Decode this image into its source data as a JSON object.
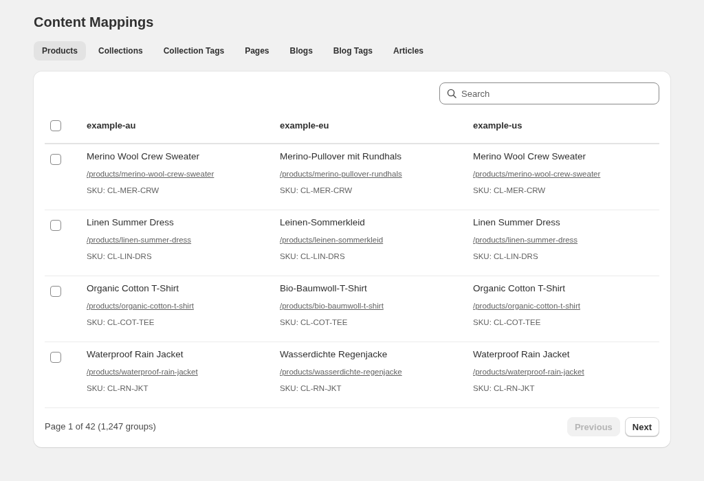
{
  "page": {
    "title": "Content Mappings"
  },
  "tabs": [
    {
      "label": "Products",
      "selected": true
    },
    {
      "label": "Collections",
      "selected": false
    },
    {
      "label": "Collection Tags",
      "selected": false
    },
    {
      "label": "Pages",
      "selected": false
    },
    {
      "label": "Blogs",
      "selected": false
    },
    {
      "label": "Blog Tags",
      "selected": false
    },
    {
      "label": "Articles",
      "selected": false
    }
  ],
  "search": {
    "placeholder": "Search"
  },
  "table": {
    "select_all": {
      "checked": false
    },
    "columns": [
      "example-au",
      "example-eu",
      "example-us"
    ],
    "rows": [
      {
        "checked": false,
        "cells": [
          {
            "name": "Merino Wool Crew Sweater",
            "url": "/products/merino-wool-crew-sweater",
            "sku": "SKU: CL-MER-CRW"
          },
          {
            "name": "Merino-Pullover mit Rundhals",
            "url": "/products/merino-pullover-rundhals",
            "sku": "SKU: CL-MER-CRW"
          },
          {
            "name": "Merino Wool Crew Sweater",
            "url": "/products/merino-wool-crew-sweater",
            "sku": "SKU: CL-MER-CRW"
          }
        ]
      },
      {
        "checked": false,
        "cells": [
          {
            "name": "Linen Summer Dress",
            "url": "/products/linen-summer-dress",
            "sku": "SKU: CL-LIN-DRS"
          },
          {
            "name": "Leinen-Sommerkleid",
            "url": "/products/leinen-sommerkleid",
            "sku": "SKU: CL-LIN-DRS"
          },
          {
            "name": "Linen Summer Dress",
            "url": "/products/linen-summer-dress",
            "sku": "SKU: CL-LIN-DRS"
          }
        ]
      },
      {
        "checked": false,
        "cells": [
          {
            "name": "Organic Cotton T-Shirt",
            "url": "/products/organic-cotton-t-shirt",
            "sku": "SKU: CL-COT-TEE"
          },
          {
            "name": "Bio-Baumwoll-T-Shirt",
            "url": "/products/bio-baumwoll-t-shirt",
            "sku": "SKU: CL-COT-TEE"
          },
          {
            "name": "Organic Cotton T-Shirt",
            "url": "/products/organic-cotton-t-shirt",
            "sku": "SKU: CL-COT-TEE"
          }
        ]
      },
      {
        "checked": false,
        "cells": [
          {
            "name": "Waterproof Rain Jacket",
            "url": "/products/waterproof-rain-jacket",
            "sku": "SKU: CL-RN-JKT"
          },
          {
            "name": "Wasserdichte Regenjacke",
            "url": "/products/wasserdichte-regenjacke",
            "sku": "SKU: CL-RN-JKT"
          },
          {
            "name": "Waterproof Rain Jacket",
            "url": "/products/waterproof-rain-jacket",
            "sku": "SKU: CL-RN-JKT"
          }
        ]
      }
    ]
  },
  "pagination": {
    "summary": "Page 1 of 42 (1,247 groups)",
    "previous": {
      "label": "Previous",
      "disabled": true
    },
    "next": {
      "label": "Next",
      "disabled": false
    }
  }
}
